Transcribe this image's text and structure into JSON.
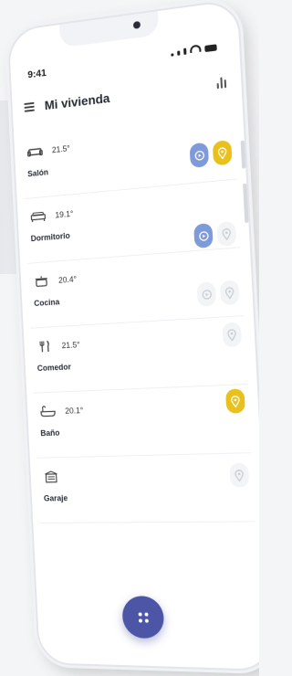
{
  "status_bar": {
    "time": "9:41"
  },
  "header": {
    "title": "Mi vivienda"
  },
  "rooms": [
    {
      "name": "Salón",
      "temperature": "21.5°",
      "icon": "sofa-icon",
      "actions": [
        "video-blue",
        "location-yellow"
      ]
    },
    {
      "name": "Dormitorio",
      "temperature": "19.1°",
      "icon": "bed-icon",
      "actions": [
        "video-blue",
        "location-off"
      ]
    },
    {
      "name": "Cocina",
      "temperature": "20.4°",
      "icon": "pot-icon",
      "actions": [
        "video-off",
        "location-off"
      ]
    },
    {
      "name": "Comedor",
      "temperature": "21.5°",
      "icon": "cutlery-icon",
      "actions": [
        "location-off"
      ]
    },
    {
      "name": "Baño",
      "temperature": "20.1°",
      "icon": "bathtub-icon",
      "actions": [
        "location-yellow"
      ]
    },
    {
      "name": "Garaje",
      "temperature": "",
      "icon": "garage-icon",
      "actions": [
        "location-off"
      ]
    }
  ],
  "colors": {
    "accent_blue": "#7f9ad8",
    "accent_yellow": "#e8c11d",
    "fab": "#4c55a6"
  }
}
